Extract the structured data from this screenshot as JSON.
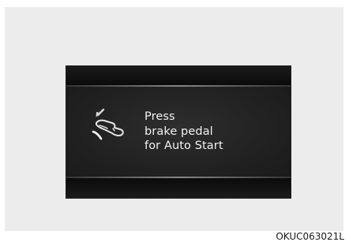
{
  "display": {
    "message_lines": [
      "Press",
      "brake pedal",
      "for Auto Start"
    ],
    "icon": "brake-pedal-press-icon",
    "background_color": "#141414",
    "text_color": "#f2f2f2"
  },
  "figure": {
    "code": "OKUC063021L"
  }
}
